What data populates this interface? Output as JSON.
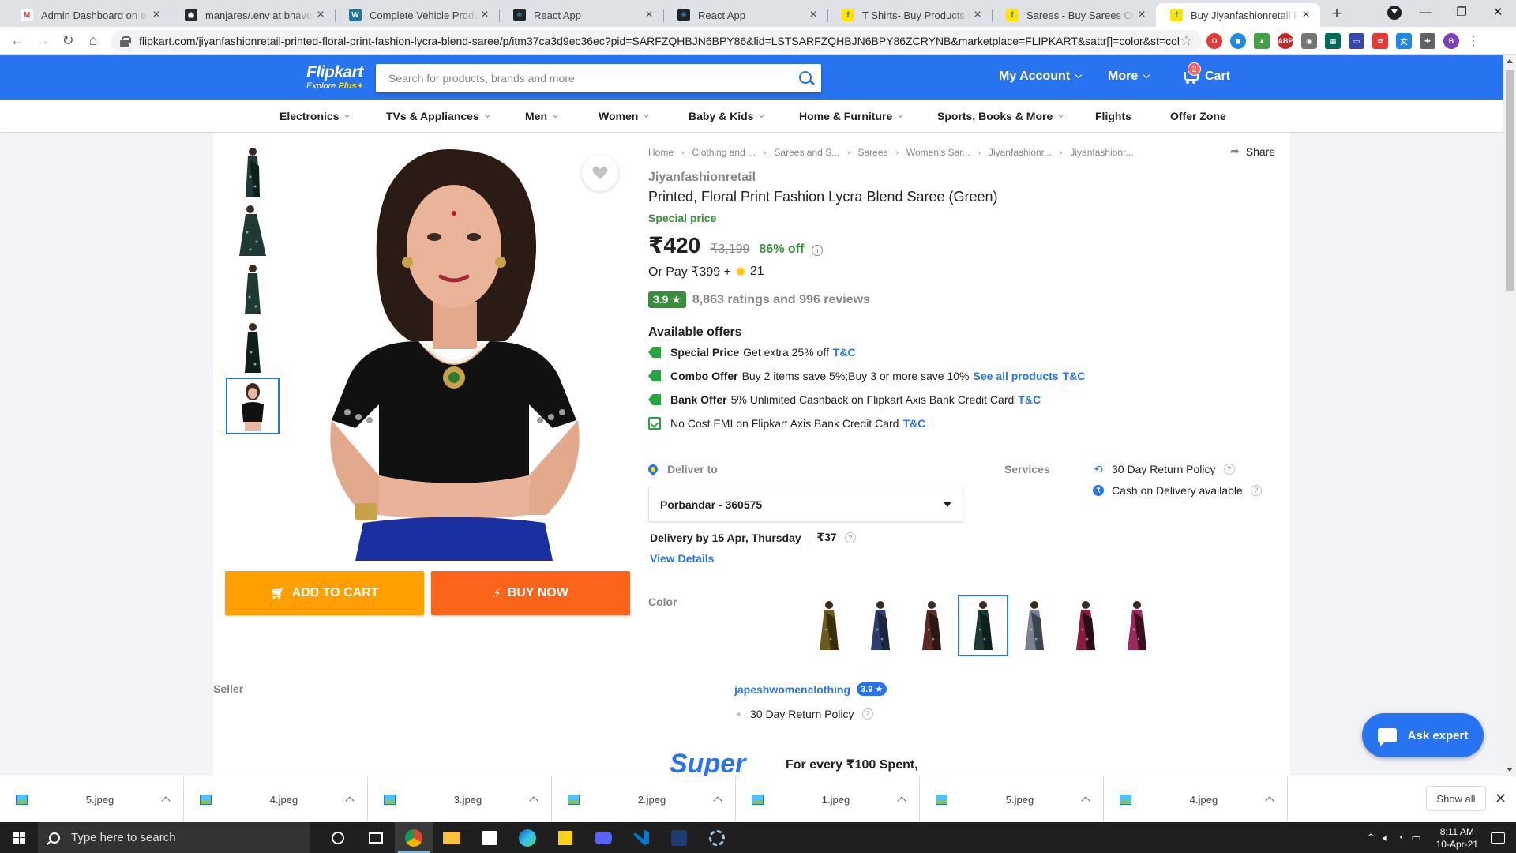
{
  "browser": {
    "tabs": [
      {
        "title": "Admin Dashboard on e-commerce",
        "favicon_color": "#ffffff",
        "favicon_text": "M",
        "favicon_fg": "#d32f2f"
      },
      {
        "title": "manjares/.env at bhavesh · GitHub",
        "favicon_color": "#24292e",
        "favicon_text": "◉",
        "favicon_fg": "#ffffff"
      },
      {
        "title": "Complete Vehicle Production",
        "favicon_color": "#21759b",
        "favicon_text": "W",
        "favicon_fg": "#ffffff"
      },
      {
        "title": "React App",
        "favicon_color": "#20232a",
        "favicon_text": "⚛",
        "favicon_fg": "#61dafb"
      },
      {
        "title": "React App",
        "favicon_color": "#20232a",
        "favicon_text": "⚛",
        "favicon_fg": "#61dafb"
      },
      {
        "title": "T Shirts- Buy Products Online",
        "favicon_color": "#ffe500",
        "favicon_text": "f",
        "favicon_fg": "#2874f0"
      },
      {
        "title": "Sarees - Buy Sarees Online",
        "favicon_color": "#ffe500",
        "favicon_text": "f",
        "favicon_fg": "#2874f0"
      },
      {
        "title": "Buy Jiyanfashionretail Printed",
        "favicon_color": "#ffe500",
        "favicon_text": "f",
        "favicon_fg": "#2874f0",
        "active": true
      }
    ],
    "url": "flipkart.com/jiyanfashionretail-printed-floral-print-fashion-lycra-blend-saree/p/itm37ca3d9ec36ec?pid=SARFZQHBJN6BPY86&lid=LSTSARFZQHBJN6BPY86ZCRYNB&marketplace=FLIPKART&sattr[]=color&st=color",
    "profile_initial": "B"
  },
  "header": {
    "logo": "Flipkart",
    "logo_sub": "Explore",
    "logo_plus": "Plus",
    "search_placeholder": "Search for products, brands and more",
    "account": "My Account",
    "more": "More",
    "cart": "Cart",
    "cart_count": "2"
  },
  "categories": [
    "Electronics",
    "TVs & Appliances",
    "Men",
    "Women",
    "Baby & Kids",
    "Home & Furniture",
    "Sports, Books & More",
    "Flights",
    "Offer Zone"
  ],
  "breadcrumbs": [
    "Home",
    "Clothing and ...",
    "Sarees and S...",
    "Sarees",
    "Women's Sar...",
    "Jiyanfashionr...",
    "Jiyanfashionr..."
  ],
  "share": "Share",
  "product": {
    "brand": "Jiyanfashionretail",
    "title": "Printed, Floral Print Fashion Lycra Blend Saree  (Green)",
    "special_label": "Special price",
    "price": "₹420",
    "mrp": "₹3,199",
    "discount": "86% off",
    "or_pay": "Or Pay ₹399 +",
    "coins": "21",
    "rating": "3.9 ★",
    "rating_summary": "8,863 ratings and 996 reviews"
  },
  "offers": {
    "heading": "Available offers",
    "items": [
      {
        "title": "Special Price",
        "text": "Get extra 25% off",
        "link": "",
        "tc": "T&C"
      },
      {
        "title": "Combo Offer",
        "text": "Buy 2 items save 5%;Buy 3 or more save 10%",
        "link": "See all products",
        "tc": "T&C"
      },
      {
        "title": "Bank Offer",
        "text": "5% Unlimited Cashback on Flipkart Axis Bank Credit Card",
        "link": "",
        "tc": "T&C"
      },
      {
        "title": "",
        "text": "No Cost EMI on Flipkart Axis Bank Credit Card",
        "link": "",
        "tc": "T&C"
      }
    ]
  },
  "delivery": {
    "label": "Deliver to",
    "pincode": "Porbandar - 360575",
    "delivery_by": "Delivery by 15 Apr, Thursday",
    "charge": "₹37",
    "view_details": "View Details"
  },
  "services": {
    "label": "Services",
    "items": [
      "30 Day Return Policy",
      "Cash on Delivery available"
    ]
  },
  "color": {
    "label": "Color",
    "swatches": [
      {
        "body": "#6b5a1e",
        "pallu": "#3a2e0c"
      },
      {
        "body": "#2c3f6b",
        "pallu": "#1b2540"
      },
      {
        "body": "#5a2a24",
        "pallu": "#2e1612"
      },
      {
        "body": "#1f3a36",
        "pallu": "#0f1f1d",
        "active": true
      },
      {
        "body": "#7a8290",
        "pallu": "#3f4550"
      },
      {
        "body": "#8c1d3a",
        "pallu": "#2a0d16"
      },
      {
        "body": "#9c2a5a",
        "pallu": "#3a1020"
      }
    ]
  },
  "seller": {
    "label": "Seller",
    "name": "japeshwomenclothing",
    "rating": "3.9 ★",
    "policy": "30 Day Return Policy"
  },
  "supercoin": {
    "logo": "Super",
    "text": "For every ₹100 Spent,"
  },
  "buttons": {
    "add_to_cart": "ADD TO CART",
    "buy_now": "BUY NOW"
  },
  "ask_expert": "Ask expert",
  "downloads": {
    "files": [
      "5.jpeg",
      "4.jpeg",
      "3.jpeg",
      "2.jpeg",
      "1.jpeg",
      "5.jpeg",
      "4.jpeg"
    ],
    "show_all": "Show all"
  },
  "taskbar": {
    "search_placeholder": "Type here to search",
    "time": "8:11 AM",
    "date": "10-Apr-21"
  },
  "colors": {
    "flipkart_blue": "#2874f0",
    "add_to_cart": "#ff9f00",
    "buy_now": "#fb641b",
    "green": "#388e3c"
  }
}
